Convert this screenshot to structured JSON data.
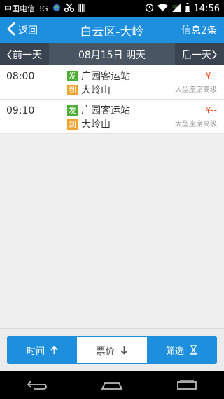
{
  "status_bar": {
    "carrier": "中国电信",
    "network": "3G",
    "time": "14:56"
  },
  "header": {
    "back_label": "返回",
    "title": "白云区-大岭",
    "info": "信息2条"
  },
  "date_bar": {
    "prev_label": "前一天",
    "current": "08月15日 明天",
    "next_label": "后一天"
  },
  "trips": [
    {
      "time": "08:00",
      "depart_badge": "发",
      "depart": "广园客运站",
      "arrive_badge": "到",
      "arrive": "大岭山",
      "price": "¥--",
      "seat": "大型座席高级"
    },
    {
      "time": "09:10",
      "depart_badge": "发",
      "depart": "广园客运站",
      "arrive_badge": "到",
      "arrive": "大岭山",
      "price": "¥--",
      "seat": "大型座席高级"
    }
  ],
  "sort_bar": {
    "time_label": "时间",
    "price_label": "票价",
    "filter_label": "筛选"
  },
  "colors": {
    "primary": "#1e8fdd",
    "date_bar": "#3a4350",
    "depart_badge": "#4cae35",
    "arrive_badge": "#f0a32b",
    "price": "#f04e23"
  },
  "icons": {
    "back": "chevron-left-icon",
    "sort_time": "arrow-up-icon",
    "sort_price": "arrow-down-icon",
    "filter": "hourglass-icon"
  }
}
